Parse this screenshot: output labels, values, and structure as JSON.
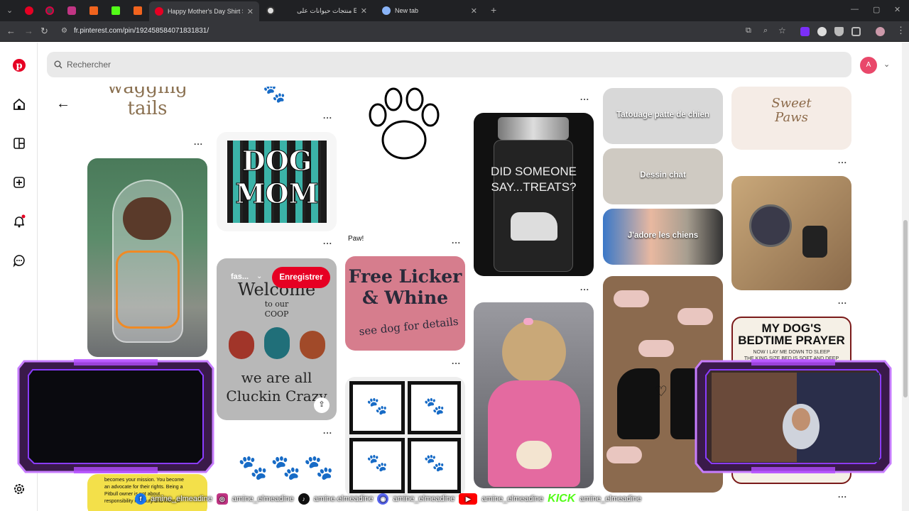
{
  "browser": {
    "tabs": [
      {
        "label": "Happy Mother's Day Shirt SVG",
        "active": true
      },
      {
        "label": "منتجات حيوانات على Etsy",
        "active": false
      },
      {
        "label": "New tab",
        "active": false
      }
    ],
    "url": "fr.pinterest.com/pin/192458584071831831/",
    "new_tab_glyph": "+",
    "colors": {
      "chrome_dark": "#202124",
      "toolbar": "#35363a"
    }
  },
  "pinterest": {
    "brand_color": "#e60023",
    "search_placeholder": "Rechercher",
    "avatar_initial": "A",
    "sidebar_icons": [
      "pinterest-logo-icon",
      "home-icon",
      "dashboard-icon",
      "create-icon",
      "notifications-icon",
      "messages-icon",
      "settings-icon"
    ],
    "hover_pin": {
      "board": "fas...",
      "save_label": "Enregistrer"
    },
    "pins": {
      "wagging_tails": "wagging\ntails",
      "dog_mom": "DOG\nMOM",
      "paw_caption": "Paw!",
      "jar": "DID SOMEONE\nSAY...TREATS?",
      "welcome_top": "Welcome",
      "welcome_mid": "to our\nCOOP",
      "welcome_bottom": "we are all\nCluckin Crazy",
      "free_licker": "Free Licker\n& Whine",
      "free_licker_sub": "see dog for details",
      "tatouage": "Tatouage patte de chien",
      "dessin_chat": "Dessin chat",
      "jadore": "J'adore les chiens",
      "sweet_paws": "Sweet\nPaws",
      "prayer_title": "MY DOG'S\nBEDTIME PRAYER",
      "prayer_sub": "NOW I LAY ME DOWN TO SLEEP\nTHE KING SIZE BED IS SOFT AND DEEP",
      "pitbull_text": "becomes your mission. You become\nan advocate for their rights. Being a\nPitbull owner is not about...\nresponsibility is a duty and most of"
    },
    "more_glyph": "..."
  },
  "stream_overlay": {
    "accent": "#b44dff",
    "socials": [
      {
        "icon": "facebook-icon",
        "handle": "amine_elmeadine"
      },
      {
        "icon": "instagram-icon",
        "handle": "amine_elmeadine"
      },
      {
        "icon": "tiktok-icon",
        "handle": "amine.elmeadine"
      },
      {
        "icon": "discord-icon",
        "handle": "amine_elmeadine"
      },
      {
        "icon": "youtube-icon",
        "handle": "amine_elmeadine"
      },
      {
        "icon": "kick-icon",
        "handle": "amine_elmeadine"
      }
    ],
    "kick_label": "KICK"
  }
}
